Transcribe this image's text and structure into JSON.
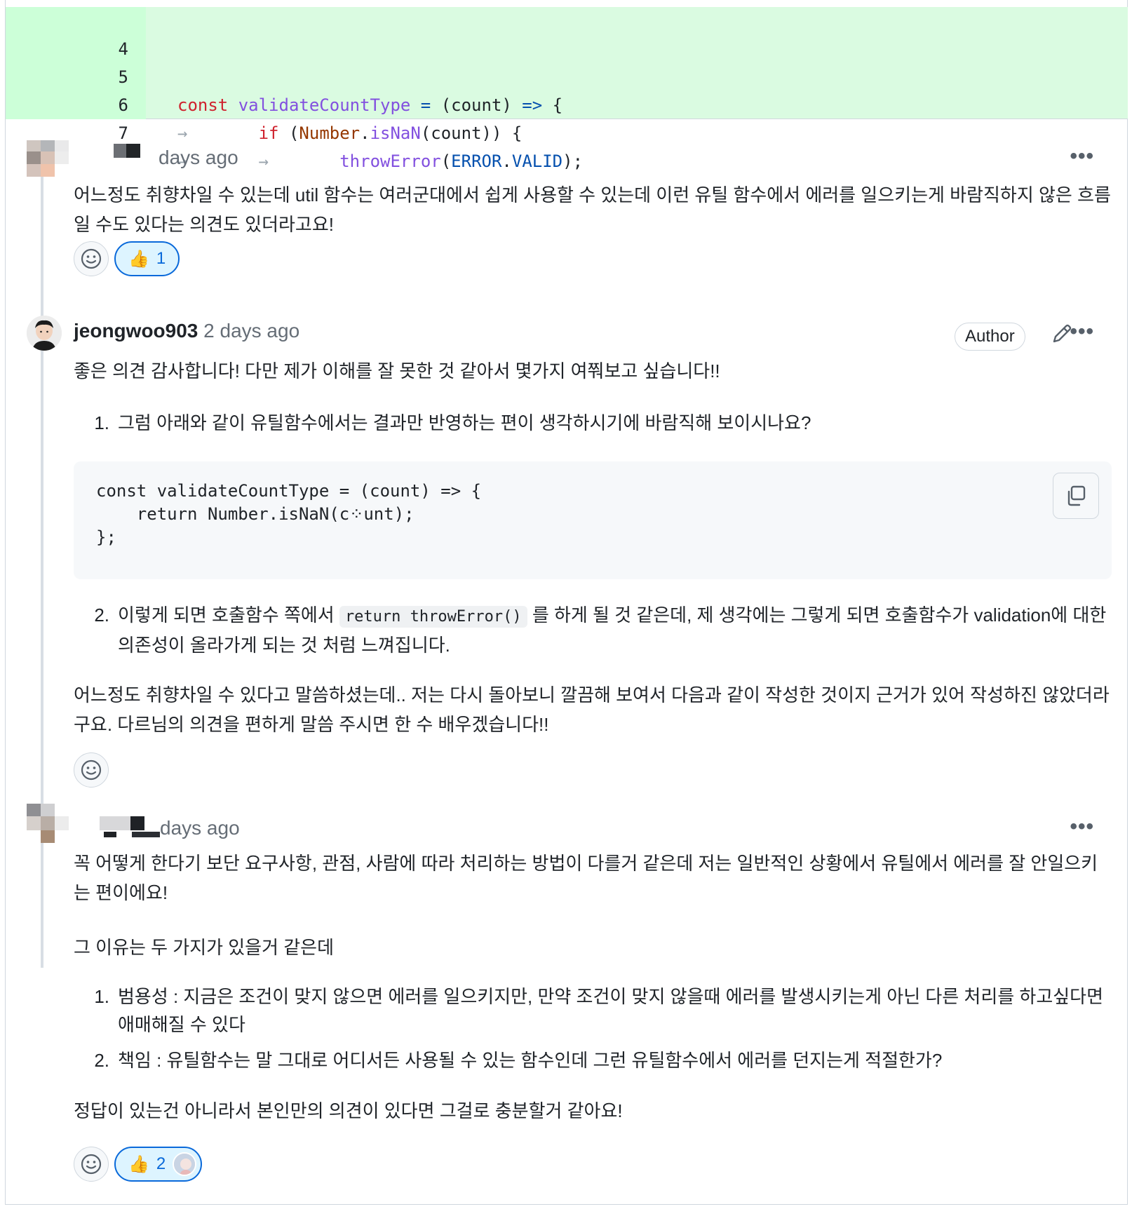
{
  "diff": {
    "lines": [
      {
        "num": "4",
        "code": ""
      },
      {
        "num": "5",
        "code": "const validateCountType = (count) => {"
      },
      {
        "num": "6",
        "code": "if (Number.isNaN(count)) {"
      },
      {
        "num": "7",
        "code": "throwError(ERROR.VALID);"
      }
    ],
    "tab_glyph": "→",
    "tokens": {
      "const": "const",
      "name": "validateCountType",
      "assign": " = ",
      "params": "(count)",
      "arrow": " => ",
      "brace_open": "{",
      "if": "if",
      "paren_open": " (",
      "number": "Number",
      "dot": ".",
      "isnan": "isNaN",
      "count_close": "(count)) {",
      "throw": "throwError",
      "p_open": "(",
      "error": "ERROR",
      "valid": "VALID",
      "close_semi": ");"
    }
  },
  "comments": [
    {
      "time": "days ago",
      "body": "어느정도 취향차일 수 있는데 util 함수는 여러군대에서 쉽게 사용할 수 있는데 이런 유틸 함수에서 에러를 일으키는게 바람직하지 않은 흐름일 수도 있다는 의견도 있더라고요!",
      "reaction_emoji": "👍",
      "reaction_count": "1"
    },
    {
      "author": "jeongwoo903",
      "time": "2 days ago",
      "badge": "Author",
      "intro": "좋은 의견 감사합니다! 다만 제가 이해를 잘 못한 것 같아서 몇가지 여쭤보고 싶습니다!!",
      "item1_num": "1.",
      "item1": "그럼 아래와 같이 유틸함수에서는 결과만 반영하는 편이 생각하시기에 바람직해 보이시나요?",
      "code_lines": [
        "const validateCountType = (count) => {",
        "    return Number.isNaN(c⁘unt);",
        "};"
      ],
      "item2_num": "2.",
      "item2_pre": "이렇게 되면 호출함수 쪽에서 ",
      "item2_code": "return throwError()",
      "item2_post": " 를 하게 될 것 같은데, 제 생각에는 그렇게 되면 호출함수가 validation에 대한 의존성이 올라가게 되는 것 처럼 느껴집니다.",
      "outro": "어느정도 취향차일 수 있다고 말씀하셨는데.. 저는 다시 돌아보니 깔끔해 보여서 다음과 같이 작성한 것이지 근거가 있어 작성하진 않았더라구요. 다르님의 의견을 편하게 말씀 주시면 한 수 배우겠습니다!!"
    },
    {
      "time": "days ago",
      "p1": "꼭 어떻게 한다기 보단 요구사항, 관점, 사람에 따라 처리하는 방법이 다를거 같은데 저는 일반적인 상황에서 유틸에서 에러를 잘 안일으키는 편이에요!",
      "p2": "그 이유는 두 가지가 있을거 같은데",
      "item1_num": "1.",
      "item1": "범용성 : 지금은 조건이 맞지 않으면 에러를 일으키지만, 만약 조건이 맞지 않을때 에러를 발생시키는게 아닌 다른 처리를 하고싶다면 애매해질 수 있다",
      "item2_num": "2.",
      "item2": "책임 : 유틸함수는 말 그대로 어디서든 사용될 수 있는 함수인데 그런 유틸함수에서 에러를 던지는게 적절한가?",
      "p3": "정답이 있는건 아니라서 본인만의 의견이 있다면 그걸로 충분할거 같아요!",
      "reaction_emoji": "👍",
      "reaction_count": "2"
    }
  ],
  "icons": {
    "kebab": "•••",
    "smiley": "smiley-icon",
    "copy": "copy-icon",
    "pencil": "pencil-icon"
  },
  "colors": {
    "diff_bg": "#dafbe1",
    "accent": "#0969da",
    "keyword": "#cf222e",
    "function": "#8250df"
  }
}
